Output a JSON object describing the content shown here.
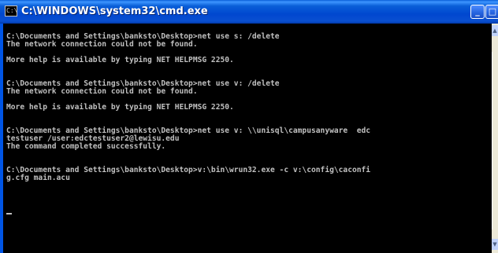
{
  "window": {
    "title": "C:\\WINDOWS\\system32\\cmd.exe",
    "icon_label": "C:\\",
    "minimize_glyph": "_",
    "maximize_glyph": "□"
  },
  "console": {
    "lines": [
      "C:\\Documents and Settings\\banksto\\Desktop>net use s: /delete",
      "The network connection could not be found.",
      "",
      "More help is available by typing NET HELPMSG 2250.",
      "",
      "",
      "C:\\Documents and Settings\\banksto\\Desktop>net use v: /delete",
      "The network connection could not be found.",
      "",
      "More help is available by typing NET HELPMSG 2250.",
      "",
      "",
      "C:\\Documents and Settings\\banksto\\Desktop>net use v: \\\\unisql\\campusanyware  edc",
      "testuser /user:edctestuser2@lewisu.edu",
      "The command completed successfully.",
      "",
      "",
      "C:\\Documents and Settings\\banksto\\Desktop>v:\\bin\\wrun32.exe -c v:\\config\\caconfi",
      "g.cfg main.acu"
    ]
  },
  "colors": {
    "titlebar": "#0a4fd0",
    "console_bg": "#000000",
    "console_fg": "#c0c0c0"
  },
  "icons": {
    "app": "cmd-icon",
    "scroll_up": "arrow-up-icon",
    "scroll_down": "arrow-down-icon"
  }
}
